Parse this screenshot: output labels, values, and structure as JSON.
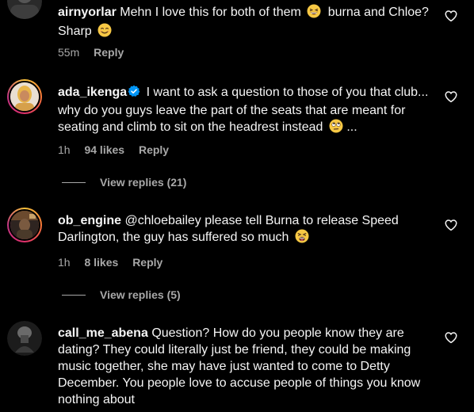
{
  "comments": [
    {
      "username": "airnyorlar",
      "text": "Mehn I love this for both of them",
      "text_mid": "burna and Chloe? Sharp",
      "emoji_1": "grinning-squinting-face-emoji",
      "emoji_2": "smiling-face-emoji",
      "time": "55m",
      "reply": "Reply"
    },
    {
      "username": "ada_ikenga",
      "verified": true,
      "text": "I want to ask a question to those of you that club... why do you guys leave the part of the seats that are meant for seating and climb to sit on the headrest instead",
      "emoji_1": "face-with-rolling-eyes-emoji",
      "trailing": "...",
      "time": "1h",
      "likes": "94 likes",
      "reply": "Reply",
      "view_replies": "View replies (21)"
    },
    {
      "username": "ob_engine",
      "text": "@chloebailey please tell Burna to release Speed Darlington, the guy has suffered so much",
      "emoji_1": "tired-face-emoji",
      "time": "1h",
      "likes": "8 likes",
      "reply": "Reply",
      "view_replies": "View replies (5)"
    },
    {
      "username": "call_me_abena",
      "text": "Question? How do you people know they are dating? They could literally just be friend, they could be making music together, she may have just wanted to come to Detty December. You people love to accuse people of things you know nothing about"
    }
  ],
  "colors": {
    "background": "#000000",
    "text": "#f5f5f5",
    "secondary": "#a8a8a8",
    "verified": "#0095f6"
  }
}
